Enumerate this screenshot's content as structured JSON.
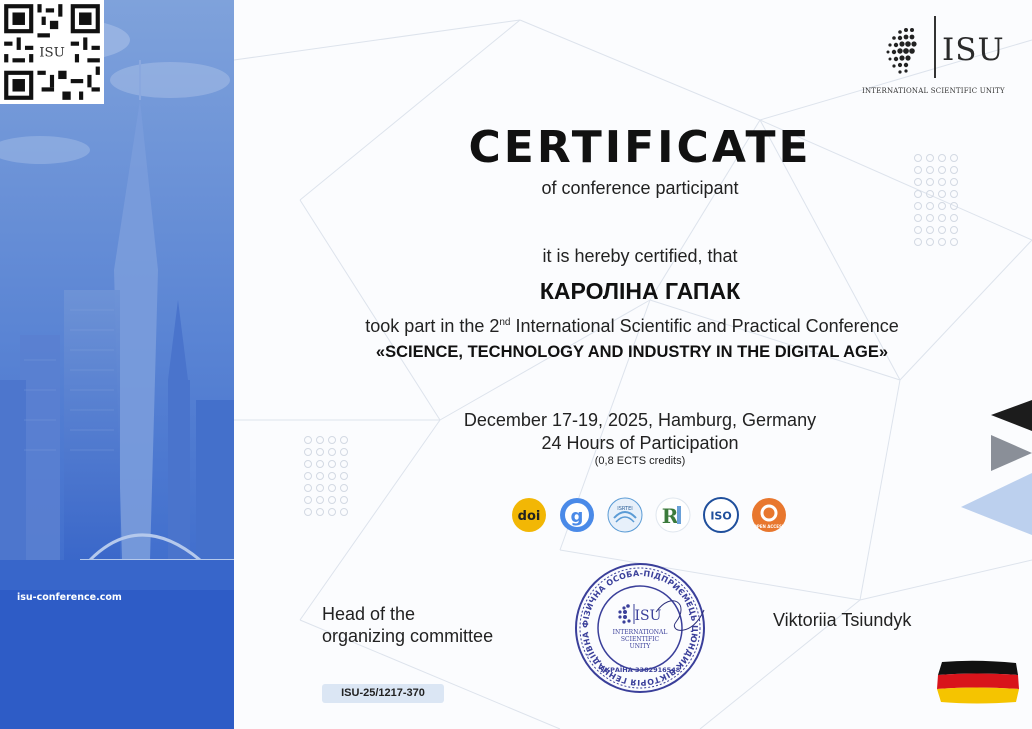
{
  "left_panel": {
    "site_url": "isu-conference.com"
  },
  "logo": {
    "brand": "ISU",
    "tagline": "INTERNATIONAL SCIENTIFIC UNITY"
  },
  "certificate": {
    "title": "CERTIFICATE",
    "subtitle": "of conference participant",
    "certified_line": "it is hereby certified, that",
    "participant_name": "КАРОЛІНА ГАПАК",
    "took_part_prefix": "took part in the 2",
    "ordinal_suffix": "nd",
    "took_part_suffix": " International Scientific and Practical Conference",
    "conference_title": "«SCIENCE, TECHNOLOGY AND INDUSTRY IN THE DIGITAL AGE»",
    "date_location": "December 17-19, 2025, Hamburg, Germany",
    "hours": "24 Hours of Participation",
    "ects": "(0,8 ECTS credits)"
  },
  "badges": [
    {
      "icon": "doi-icon",
      "label": "doi",
      "color": "#f2b705"
    },
    {
      "icon": "google-scholar-icon",
      "label": "g",
      "color": "#4a8ae8"
    },
    {
      "icon": "isrtei-icon",
      "label": "ISRTEI",
      "color": "#5a9bd5"
    },
    {
      "icon": "rb-icon",
      "label": "R",
      "color": "#3b7a3b"
    },
    {
      "icon": "iso-icon",
      "label": "ISO",
      "color": "#1f4f9c"
    },
    {
      "icon": "open-access-icon",
      "label": "OPEN ACCESS",
      "color": "#e8772e"
    }
  ],
  "signature": {
    "head_label_line1": "Head of the",
    "head_label_line2": "organizing committee",
    "signer_name": "Viktoriia Tsiundyk"
  },
  "stamp": {
    "ring_text": "ФІЗИЧНА ОСОБА-ПІДПРИЄМЕЦЬ ЦЮНДИК ВІКТОРІЯ ГЕННАДІЇВНА",
    "bottom_text": "УКРАЇНА 3382916548",
    "center_brand": "ISU",
    "center_line1": "INTERNATIONAL",
    "center_line2": "SCIENTIFIC",
    "center_line3": "UNITY"
  },
  "document_id": "ISU-25/1217-370",
  "colors": {
    "panel_blue": "#3f6fd0",
    "stamp_blue": "#3a3f9a",
    "flag_black": "#111111",
    "flag_red": "#d8141b",
    "flag_gold": "#f5c400"
  }
}
